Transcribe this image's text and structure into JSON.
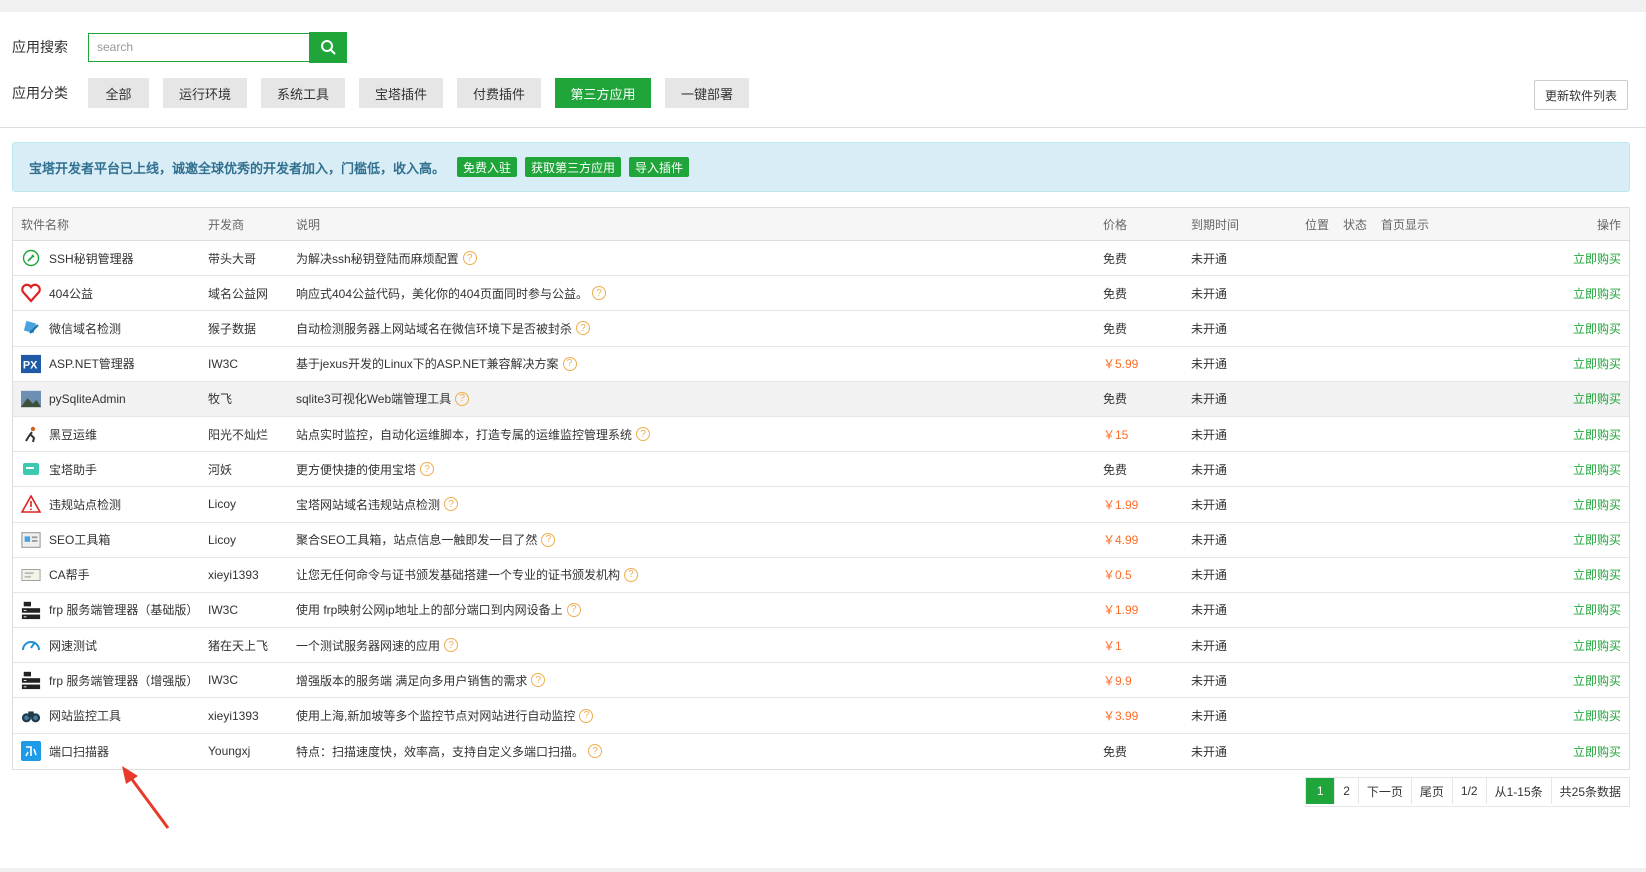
{
  "search": {
    "label": "应用搜索",
    "placeholder": "search"
  },
  "category": {
    "label": "应用分类",
    "items": [
      "全部",
      "运行环境",
      "系统工具",
      "宝塔插件",
      "付费插件",
      "第三方应用",
      "一键部署"
    ],
    "active": "第三方应用"
  },
  "update_button": "更新软件列表",
  "alert": {
    "text": "宝塔开发者平台已上线，诚邀全球优秀的开发者加入，门槛低，收入高。",
    "buttons": [
      "免费入驻",
      "获取第三方应用",
      "导入插件"
    ]
  },
  "table": {
    "headers": {
      "name": "软件名称",
      "developer": "开发商",
      "description": "说明",
      "price": "价格",
      "expire": "到期时间",
      "position": "位置",
      "status": "状态",
      "home": "首页显示",
      "op": "操作"
    },
    "rows": [
      {
        "name": "SSH秘钥管理器",
        "developer": "带头大哥",
        "description": "为解决ssh秘钥登陆而麻烦配置",
        "price": "免费",
        "expire": "未开通",
        "action": "立即购买",
        "icon": "key-icon"
      },
      {
        "name": "404公益",
        "developer": "域名公益网",
        "description": "响应式404公益代码，美化你的404页面同时参与公益。",
        "price": "免费",
        "expire": "未开通",
        "action": "立即购买",
        "icon": "heart-icon"
      },
      {
        "name": "微信域名检测",
        "developer": "猴子数据",
        "description": "自动检测服务器上网站域名在微信环境下是否被封杀",
        "price": "免费",
        "expire": "未开通",
        "action": "立即购买",
        "icon": "wechat-check-icon"
      },
      {
        "name": "ASP.NET管理器",
        "developer": "IW3C",
        "description": "基于jexus开发的Linux下的ASP.NET兼容解决方案",
        "price": "￥5.99",
        "expire": "未开通",
        "action": "立即购买",
        "icon": "px-icon"
      },
      {
        "name": "pySqliteAdmin",
        "developer": "牧飞",
        "description": "sqlite3可视化Web端管理工具",
        "price": "免费",
        "expire": "未开通",
        "action": "立即购买",
        "icon": "landscape-icon"
      },
      {
        "name": "黑豆运维",
        "developer": "阳光不灿烂",
        "description": "站点实时监控，自动化运维脚本，打造专属的运维监控管理系统",
        "price": "￥15",
        "expire": "未开通",
        "action": "立即购买",
        "icon": "runner-icon"
      },
      {
        "name": "宝塔助手",
        "developer": "河妖",
        "description": "更方便快捷的使用宝塔",
        "price": "免费",
        "expire": "未开通",
        "action": "立即购买",
        "icon": "card-icon"
      },
      {
        "name": "违规站点检测",
        "developer": "Licoy",
        "description": "宝塔网站域名违规站点检测",
        "price": "￥1.99",
        "expire": "未开通",
        "action": "立即购买",
        "icon": "warning-icon"
      },
      {
        "name": "SEO工具箱",
        "developer": "Licoy",
        "description": "聚合SEO工具箱，站点信息一触即发一目了然",
        "price": "￥4.99",
        "expire": "未开通",
        "action": "立即购买",
        "icon": "seo-icon"
      },
      {
        "name": "CA帮手",
        "developer": "xieyi1393",
        "description": "让您无任何命令与证书颁发基础搭建一个专业的证书颁发机构",
        "price": "￥0.5",
        "expire": "未开通",
        "action": "立即购买",
        "icon": "certificate-icon"
      },
      {
        "name": "frp 服务端管理器（基础版）",
        "developer": "IW3C",
        "description": "使用 frp映射公网ip地址上的部分端口到内网设备上",
        "price": "￥1.99",
        "expire": "未开通",
        "action": "立即购买",
        "icon": "server-icon"
      },
      {
        "name": "网速测试",
        "developer": "猪在天上飞",
        "description": "一个测试服务器网速的应用",
        "price": "￥1",
        "expire": "未开通",
        "action": "立即购买",
        "icon": "speedometer-icon"
      },
      {
        "name": "frp 服务端管理器（增强版）",
        "developer": "IW3C",
        "description": "增强版本的服务端 满足向多用户销售的需求",
        "price": "￥9.9",
        "expire": "未开通",
        "action": "立即购买",
        "icon": "server-icon"
      },
      {
        "name": "网站监控工具",
        "developer": "xieyi1393",
        "description": "使用上海,新加坡等多个监控节点对网站进行自动监控",
        "price": "￥3.99",
        "expire": "未开通",
        "action": "立即购买",
        "icon": "binoculars-icon"
      },
      {
        "name": "端口扫描器",
        "developer": "Youngxj",
        "description": "特点：扫描速度快，效率高，支持自定义多端口扫描。",
        "price": "免费",
        "expire": "未开通",
        "action": "立即购买",
        "icon": "port-scan-icon"
      }
    ]
  },
  "pagination": {
    "pages": [
      "1",
      "2"
    ],
    "current": "1",
    "next": "下一页",
    "last": "尾页",
    "page_info": "1/2",
    "range": "从1-15条",
    "total": "共25条数据"
  },
  "colors": {
    "accent": "#20a53a",
    "price": "#fc6d26",
    "alert_bg": "#d9edf7",
    "arrow": "#e8392b"
  }
}
